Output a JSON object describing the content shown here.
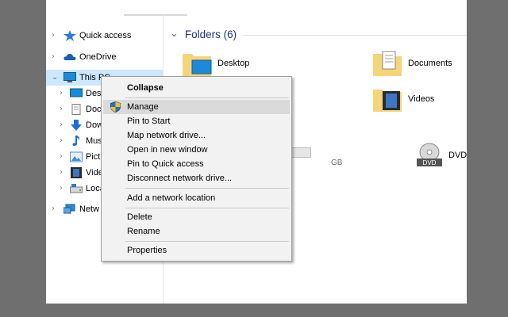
{
  "nav": {
    "quick_access": "Quick access",
    "onedrive": "OneDrive",
    "this_pc": "This PC",
    "children": [
      "Desk",
      "Doc",
      "Dow",
      "Mus",
      "Pict",
      "Vide",
      "Loca"
    ],
    "network": "Netw"
  },
  "content": {
    "group_title": "Folders (6)",
    "folders": {
      "desktop": "Desktop",
      "documents": "Documents",
      "videos": "Videos"
    },
    "drive_free_partial": "GB",
    "drive_used_fraction": 0.14,
    "dvd_label": "DVD RW Drive (E",
    "dvd_badge": "DVD"
  },
  "context_menu": {
    "collapse": "Collapse",
    "manage": "Manage",
    "pin_to_start": "Pin to Start",
    "map_network_drive": "Map network drive...",
    "open_new_window": "Open in new window",
    "pin_quick_access": "Pin to Quick access",
    "disconnect_network_drive": "Disconnect network drive...",
    "add_network_location": "Add a network location",
    "delete": "Delete",
    "rename": "Rename",
    "properties": "Properties"
  },
  "colors": {
    "selection": "#cce8ff",
    "header_blue": "#1e3287",
    "menu_bg": "#f2f2f2",
    "drive_bar": "#26a0da"
  }
}
